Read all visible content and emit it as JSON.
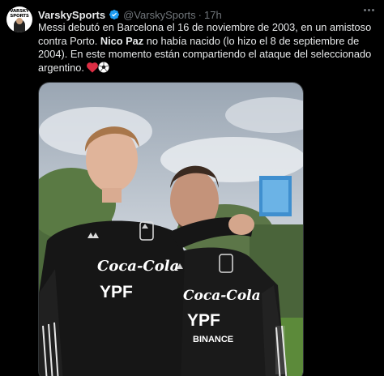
{
  "tweet": {
    "avatar_text": "VARSKY\nSPORTS",
    "display_name": "VarskySports",
    "handle": "@VarskySports",
    "separator": "·",
    "timestamp": "17h",
    "body_part1": "Messi debutó en Barcelona el 16 de noviembre de 2003, en un amistoso contra Porto. ",
    "body_bold": "Nico Paz",
    "body_part2": " no había nacido (lo hizo el 8 de septiembre de 2004). En este momento están compartiendo el ataque del seleccionado argentino. ",
    "media": {
      "shirt_left_sponsor": "Coca-Cola",
      "shirt_left_brand": "YPF",
      "shirt_right_sponsor": "Coca-Cola",
      "shirt_right_brand": "YPF",
      "shirt_right_extra": "BINANCE"
    }
  },
  "icons": {
    "verified": "verified-badge-icon",
    "more": "more-options-icon",
    "heart": "red-heart-emoji",
    "ball": "soccer-ball-emoji"
  },
  "colors": {
    "background": "#000000",
    "text": "#e7e9ea",
    "muted": "#71767b",
    "verified": "#1d9bf0",
    "heart": "#f91880"
  }
}
